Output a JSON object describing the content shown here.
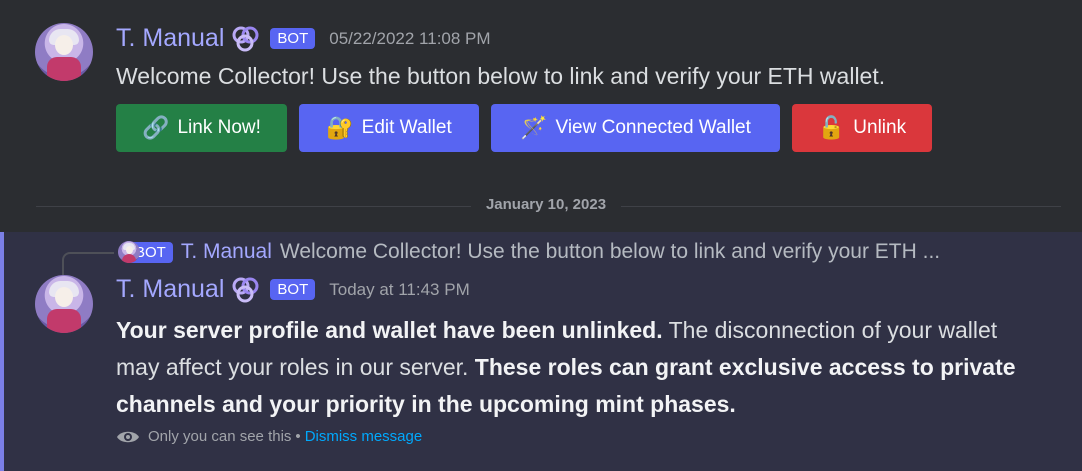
{
  "message1": {
    "username": "T. Manual",
    "bot_label": "BOT",
    "timestamp": "05/22/2022 11:08 PM",
    "text": "Welcome Collector! Use the button below to link and verify your ETH wallet.",
    "buttons": [
      {
        "emoji": "🔗",
        "label": "Link Now!",
        "color": "#248046"
      },
      {
        "emoji": "🔐",
        "label": "Edit Wallet",
        "color": "#5865f2"
      },
      {
        "emoji": "🪄",
        "label": "View Connected Wallet",
        "color": "#5865f2"
      },
      {
        "emoji": "🔓",
        "label": "Unlink",
        "color": "#da373c"
      }
    ]
  },
  "divider": {
    "date": "January 10, 2023"
  },
  "message2": {
    "reply": {
      "bot_label": "BOT",
      "username": "T. Manual",
      "text": "Welcome Collector! Use the button below to link and verify your ETH ..."
    },
    "username": "T. Manual",
    "bot_label": "BOT",
    "timestamp": "Today at 11:43 PM",
    "body": {
      "bold1": "Your server profile and wallet have been unlinked.",
      "normal": " The disconnection of your wallet may affect your roles in our server. ",
      "bold2": "These roles can grant exclusive access to private channels and your priority in the upcoming mint phases."
    },
    "ephemeral": {
      "notice": "Only you can see this",
      "separator": "•",
      "dismiss": "Dismiss message"
    }
  },
  "colors": {
    "accent": "#5865f2",
    "username": "#a4a8ff",
    "link": "#00a8fc",
    "highlight_border": "#7b7fe6"
  }
}
